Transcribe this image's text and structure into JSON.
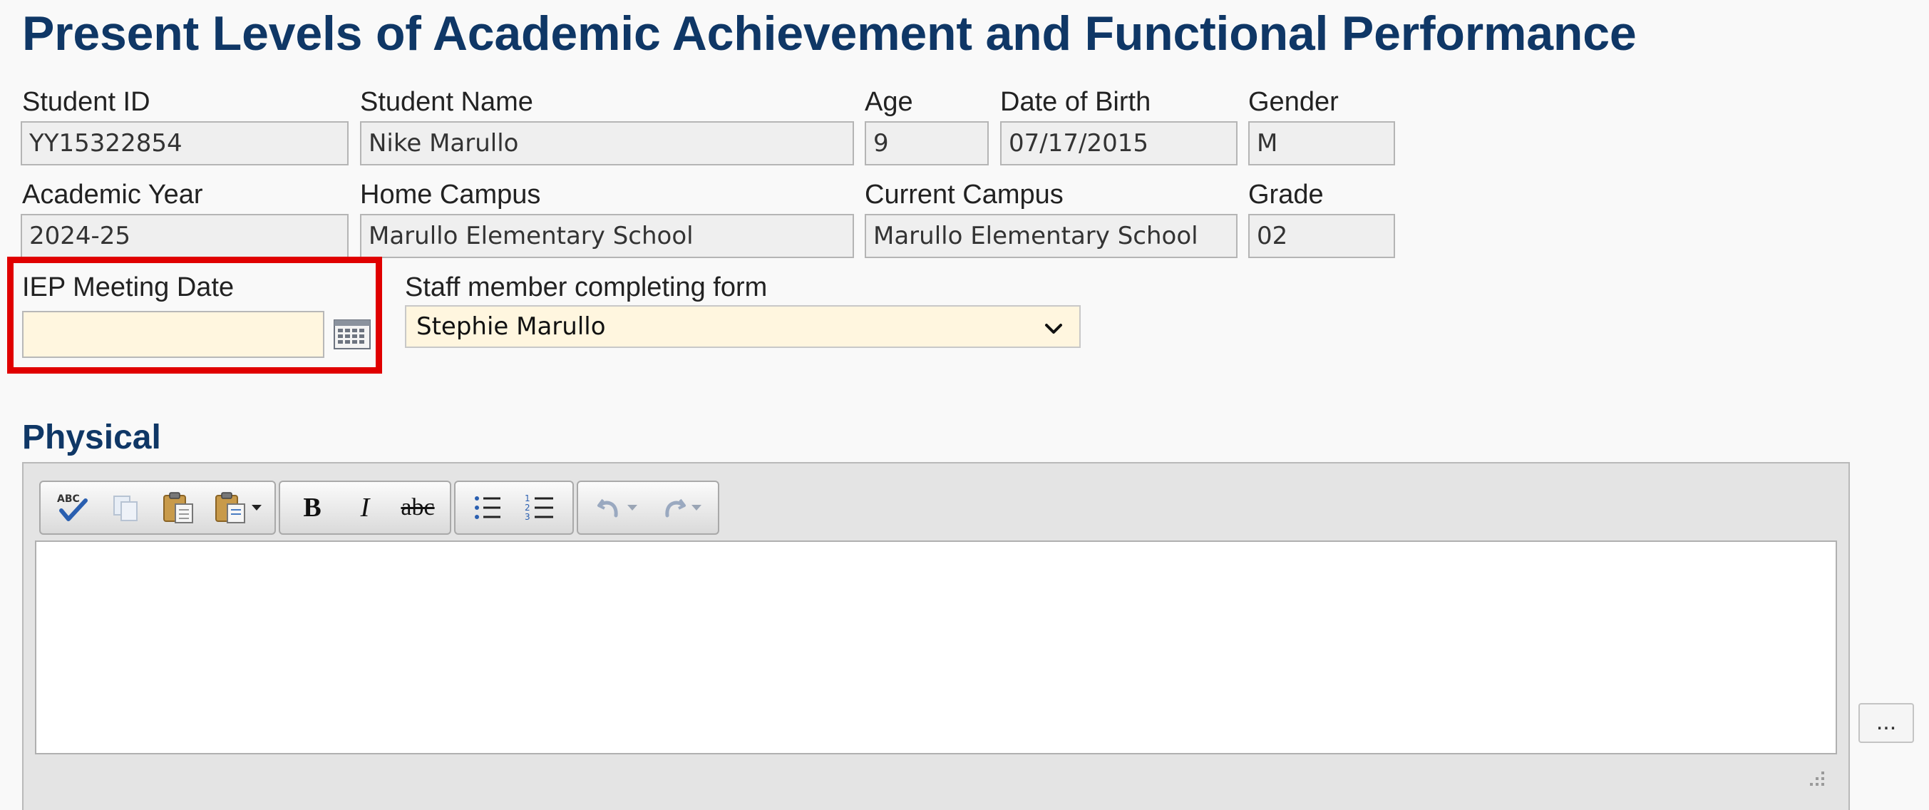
{
  "page": {
    "title": "Present Levels of Academic Achievement and Functional Performance"
  },
  "student": {
    "id_label": "Student ID",
    "id_value": "YY15322854",
    "name_label": "Student Name",
    "name_value": "Nike Marullo",
    "age_label": "Age",
    "age_value": "9",
    "dob_label": "Date of Birth",
    "dob_value": "07/17/2015",
    "gender_label": "Gender",
    "gender_value": "M",
    "year_label": "Academic Year",
    "year_value": "2024-25",
    "home_campus_label": "Home Campus",
    "home_campus_value": "Marullo Elementary School",
    "current_campus_label": "Current Campus",
    "current_campus_value": "Marullo Elementary School",
    "grade_label": "Grade",
    "grade_value": "02"
  },
  "meeting": {
    "date_label": "IEP Meeting Date",
    "date_value": "",
    "date_placeholder": "",
    "calendar_icon": "calendar-icon",
    "highlight_color": "#e00000"
  },
  "staff": {
    "label": "Staff member completing form",
    "selected": "Stephie Marullo"
  },
  "physical": {
    "section_title": "Physical",
    "toolbar": {
      "icons": [
        "spellcheck-icon",
        "copy-icon",
        "paste-icon",
        "paste-special-icon",
        "bold-icon",
        "italic-icon",
        "strikethrough-icon",
        "bullet-list-icon",
        "numbered-list-icon",
        "undo-icon",
        "redo-icon"
      ],
      "bold_glyph": "B",
      "italic_glyph": "I",
      "strike_glyph": "abc"
    },
    "more_button": "..."
  },
  "colors": {
    "title": "#0f3766",
    "input_bg": "#fff6df",
    "readonly_bg": "#efefef"
  }
}
